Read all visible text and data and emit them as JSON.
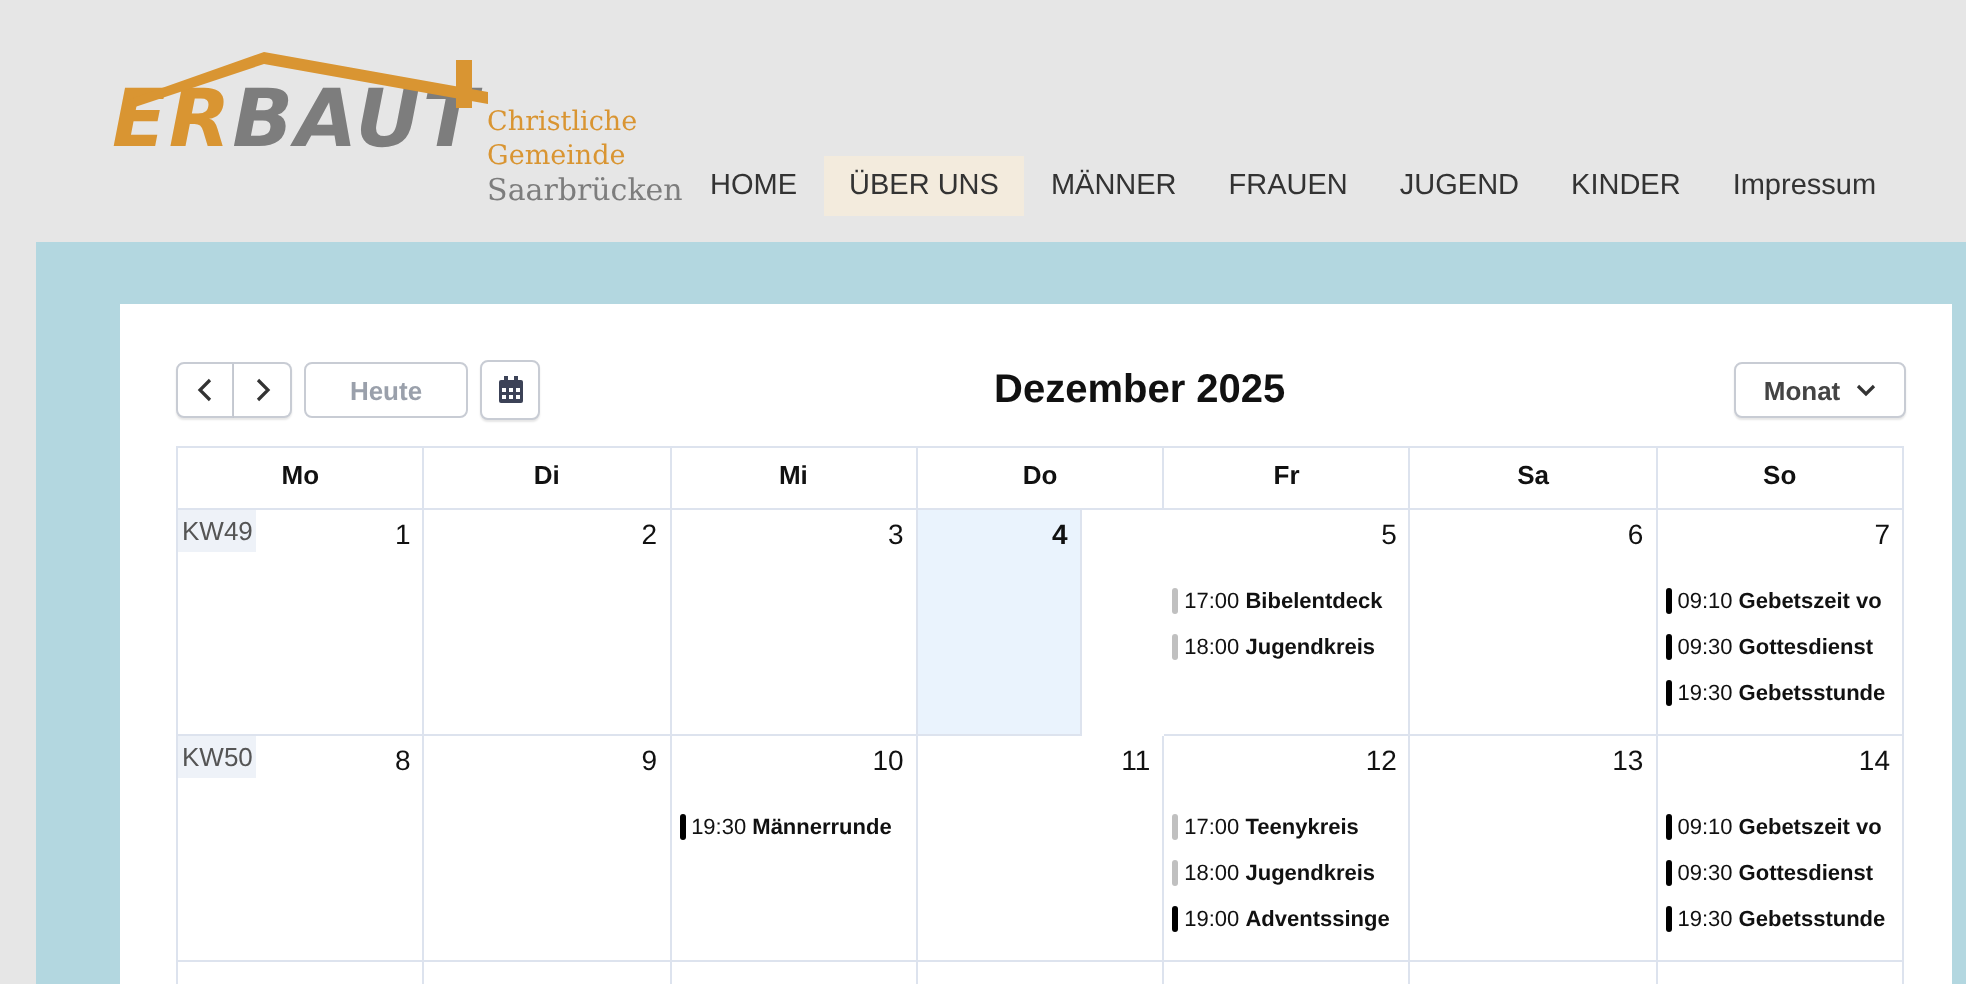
{
  "logo": {
    "wordmark_part_1": "ER",
    "wordmark_part_2": "BAUT",
    "lines": [
      "Christliche",
      "Gemeinde",
      "Saarbrücken"
    ]
  },
  "nav": [
    {
      "label": "HOME",
      "selected": false
    },
    {
      "label": "ÜBER UNS",
      "selected": true
    },
    {
      "label": "MÄNNER",
      "selected": false
    },
    {
      "label": "FRAUEN",
      "selected": false
    },
    {
      "label": "JUGEND",
      "selected": false
    },
    {
      "label": "KINDER",
      "selected": false
    },
    {
      "label": "Impressum",
      "selected": false
    }
  ],
  "calendar": {
    "today_button": "Heute",
    "title": "Dezember 2025",
    "view_button": "Monat",
    "weekdays": [
      "Mo",
      "Di",
      "Mi",
      "Do",
      "Fr",
      "Sa",
      "So"
    ],
    "weeks": [
      {
        "label": "KW49",
        "days": [
          {
            "number": "1",
            "today": false
          },
          {
            "number": "2",
            "today": false
          },
          {
            "number": "3",
            "today": false
          },
          {
            "number": "4",
            "today": true
          },
          {
            "number": "5",
            "today": false,
            "events": [
              {
                "time": "17:00",
                "title": "Bibelentdeck",
                "color": "#c0c0c0"
              },
              {
                "time": "18:00",
                "title": "Jugendkreis",
                "color": "#c0c0c0"
              }
            ]
          },
          {
            "number": "6",
            "today": false
          },
          {
            "number": "7",
            "today": false,
            "events": [
              {
                "time": "09:10",
                "title": "Gebetszeit vo",
                "color": "#000000"
              },
              {
                "time": "09:30",
                "title": "Gottesdienst",
                "color": "#000000"
              },
              {
                "time": "19:30",
                "title": "Gebetsstunde",
                "color": "#000000"
              }
            ]
          }
        ]
      },
      {
        "label": "KW50",
        "days": [
          {
            "number": "8",
            "today": false
          },
          {
            "number": "9",
            "today": false
          },
          {
            "number": "10",
            "today": false,
            "events": [
              {
                "time": "19:30",
                "title": "Männerrunde",
                "color": "#000000"
              }
            ]
          },
          {
            "number": "11",
            "today": false
          },
          {
            "number": "12",
            "today": false,
            "events": [
              {
                "time": "17:00",
                "title": "Teenykreis",
                "color": "#c0c0c0"
              },
              {
                "time": "18:00",
                "title": "Jugendkreis",
                "color": "#c0c0c0"
              },
              {
                "time": "19:00",
                "title": "Adventssinge",
                "color": "#000000"
              }
            ]
          },
          {
            "number": "13",
            "today": false
          },
          {
            "number": "14",
            "today": false,
            "events": [
              {
                "time": "09:10",
                "title": "Gebetszeit vo",
                "color": "#000000"
              },
              {
                "time": "09:30",
                "title": "Gottesdienst",
                "color": "#000000"
              },
              {
                "time": "19:30",
                "title": "Gebetsstunde",
                "color": "#000000"
              }
            ]
          }
        ]
      }
    ]
  }
}
